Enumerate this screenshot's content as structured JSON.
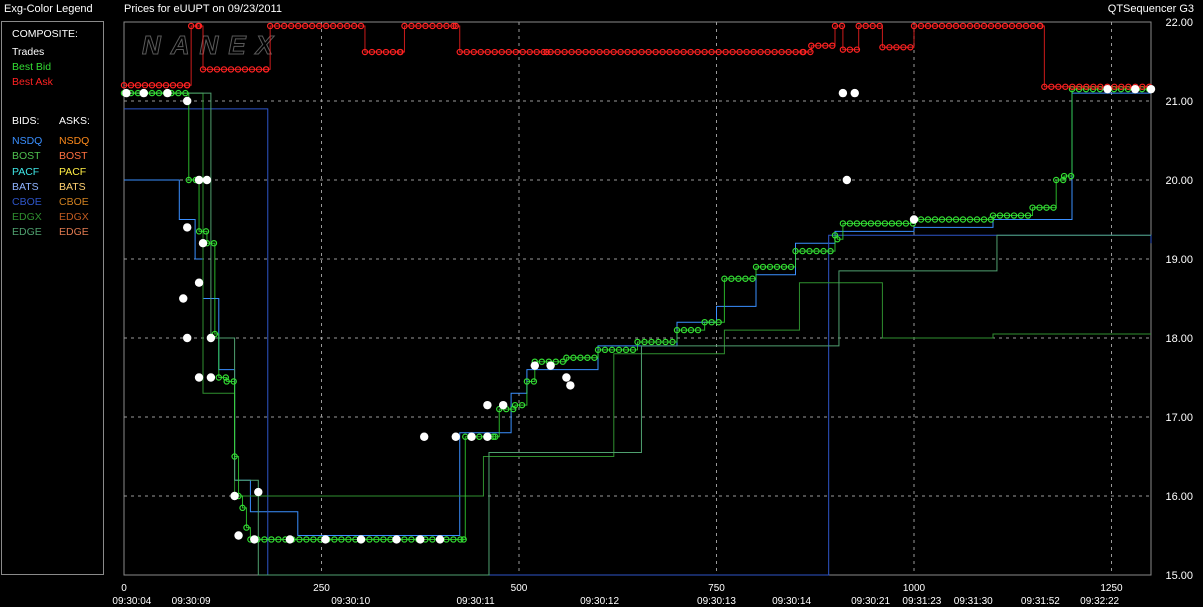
{
  "header": {
    "legend_title": "Exg-Color Legend",
    "chart_title": "Prices for  eUUPT  on  09/23/2011",
    "app_name": "QTSequencer G3"
  },
  "watermark": "NANEX",
  "legend": {
    "composite_heading": "COMPOSITE:",
    "composite": [
      {
        "label": "Trades",
        "color": "#ffffff"
      },
      {
        "label": "Best Bid",
        "color": "#33dd33"
      },
      {
        "label": "Best Ask",
        "color": "#ff2222"
      }
    ],
    "bids_heading": "BIDS:",
    "asks_heading": "ASKS:",
    "bids": [
      {
        "label": "NSDQ",
        "color": "#3a8fff"
      },
      {
        "label": "BOST",
        "color": "#4fc04f"
      },
      {
        "label": "PACF",
        "color": "#3ee6e6"
      },
      {
        "label": "BATS",
        "color": "#8fb4ff"
      },
      {
        "label": "CBOE",
        "color": "#2e55c8"
      },
      {
        "label": "EDGX",
        "color": "#2f8f2f"
      },
      {
        "label": "EDGE",
        "color": "#4fa06f"
      }
    ],
    "asks": [
      {
        "label": "NSDQ",
        "color": "#ff8a1a"
      },
      {
        "label": "BOST",
        "color": "#ff7040"
      },
      {
        "label": "PACF",
        "color": "#ffee44"
      },
      {
        "label": "BATS",
        "color": "#ffd070"
      },
      {
        "label": "CBOE",
        "color": "#d08020"
      },
      {
        "label": "EDGX",
        "color": "#c05a20"
      },
      {
        "label": "EDGE",
        "color": "#e07a50"
      }
    ]
  },
  "chart_data": {
    "type": "line",
    "title": "Prices for  eUUPT  on  09/23/2011",
    "xlim": [
      0,
      1300
    ],
    "ylim": [
      15.0,
      22.0
    ],
    "grid": true,
    "legend_placement": "left panel",
    "y_ticks": [
      "15.00",
      "16.00",
      "17.00",
      "18.00",
      "19.00",
      "20.00",
      "21.00",
      "22.00"
    ],
    "x_ticks": [
      0,
      250,
      500,
      750,
      1000,
      1250
    ],
    "time_labels": [
      {
        "x": 10,
        "label": "09:30:04"
      },
      {
        "x": 85,
        "label": "09:30:09"
      },
      {
        "x": 287,
        "label": "09:30:10"
      },
      {
        "x": 445,
        "label": "09:30:11"
      },
      {
        "x": 602,
        "label": "09:30:12"
      },
      {
        "x": 750,
        "label": "09:30:13"
      },
      {
        "x": 845,
        "label": "09:30:14"
      },
      {
        "x": 945,
        "label": "09:30:21"
      },
      {
        "x": 1010,
        "label": "09:31:23"
      },
      {
        "x": 1075,
        "label": "09:31:30"
      },
      {
        "x": 1160,
        "label": "09:31:52"
      },
      {
        "x": 1235,
        "label": "09:32:22"
      }
    ],
    "series": [
      {
        "name": "Trades",
        "kind": "dots",
        "color": "#ffffff",
        "points": [
          [
            3,
            21.1
          ],
          [
            25,
            21.1
          ],
          [
            55,
            21.1
          ],
          [
            80,
            21.0
          ],
          [
            95,
            20.0
          ],
          [
            105,
            20.0
          ],
          [
            80,
            19.4
          ],
          [
            100,
            19.2
          ],
          [
            95,
            18.7
          ],
          [
            75,
            18.5
          ],
          [
            80,
            18.0
          ],
          [
            110,
            18.0
          ],
          [
            95,
            17.5
          ],
          [
            110,
            17.5
          ],
          [
            140,
            16.0
          ],
          [
            170,
            16.05
          ],
          [
            145,
            15.5
          ],
          [
            165,
            15.45
          ],
          [
            210,
            15.45
          ],
          [
            255,
            15.45
          ],
          [
            300,
            15.45
          ],
          [
            345,
            15.45
          ],
          [
            375,
            15.45
          ],
          [
            400,
            15.45
          ],
          [
            380,
            16.75
          ],
          [
            420,
            16.75
          ],
          [
            440,
            16.75
          ],
          [
            460,
            16.75
          ],
          [
            460,
            17.15
          ],
          [
            480,
            17.15
          ],
          [
            520,
            17.65
          ],
          [
            540,
            17.65
          ],
          [
            560,
            17.5
          ],
          [
            565,
            17.4
          ],
          [
            910,
            21.1
          ],
          [
            925,
            21.1
          ],
          [
            915,
            20.0
          ],
          [
            1000,
            19.5
          ],
          [
            1245,
            21.15
          ],
          [
            1280,
            21.15
          ],
          [
            1300,
            21.15
          ]
        ]
      },
      {
        "name": "Best Bid",
        "kind": "step-dots",
        "color": "#33dd33",
        "points": [
          [
            0,
            21.1
          ],
          [
            60,
            21.1
          ],
          [
            82,
            20.0
          ],
          [
            95,
            19.35
          ],
          [
            105,
            19.2
          ],
          [
            115,
            18.05
          ],
          [
            120,
            17.5
          ],
          [
            130,
            17.45
          ],
          [
            140,
            16.5
          ],
          [
            145,
            16.0
          ],
          [
            150,
            15.85
          ],
          [
            155,
            15.6
          ],
          [
            160,
            15.45
          ],
          [
            430,
            15.45
          ],
          [
            432,
            16.75
          ],
          [
            470,
            16.75
          ],
          [
            475,
            17.1
          ],
          [
            495,
            17.15
          ],
          [
            510,
            17.45
          ],
          [
            520,
            17.7
          ],
          [
            560,
            17.75
          ],
          [
            600,
            17.85
          ],
          [
            650,
            17.95
          ],
          [
            700,
            18.1
          ],
          [
            735,
            18.2
          ],
          [
            760,
            18.75
          ],
          [
            800,
            18.9
          ],
          [
            850,
            19.1
          ],
          [
            900,
            19.3
          ],
          [
            903,
            19.25
          ],
          [
            910,
            19.45
          ],
          [
            1000,
            19.5
          ],
          [
            1100,
            19.55
          ],
          [
            1150,
            19.65
          ],
          [
            1180,
            20.0
          ],
          [
            1190,
            20.05
          ],
          [
            1200,
            21.15
          ],
          [
            1300,
            21.15
          ]
        ]
      },
      {
        "name": "Best Ask",
        "kind": "step-dots",
        "color": "#ff2222",
        "points": [
          [
            0,
            21.2
          ],
          [
            80,
            21.2
          ],
          [
            85,
            21.95
          ],
          [
            95,
            21.95
          ],
          [
            100,
            21.4
          ],
          [
            180,
            21.4
          ],
          [
            185,
            21.95
          ],
          [
            300,
            21.95
          ],
          [
            305,
            21.62
          ],
          [
            350,
            21.62
          ],
          [
            355,
            21.95
          ],
          [
            420,
            21.95
          ],
          [
            425,
            21.62
          ],
          [
            535,
            21.62
          ],
          [
            540,
            21.62
          ],
          [
            860,
            21.62
          ],
          [
            870,
            21.7
          ],
          [
            900,
            21.95
          ],
          [
            910,
            21.65
          ],
          [
            930,
            21.95
          ],
          [
            960,
            21.68
          ],
          [
            1000,
            21.95
          ],
          [
            1160,
            21.95
          ],
          [
            1165,
            21.18
          ],
          [
            1300,
            21.18
          ]
        ]
      },
      {
        "name": "NSDQ",
        "kind": "line",
        "color": "#3a8fff",
        "points": [
          [
            0,
            20.0
          ],
          [
            60,
            20.0
          ],
          [
            70,
            19.5
          ],
          [
            90,
            19.0
          ],
          [
            100,
            18.5
          ],
          [
            120,
            17.6
          ],
          [
            140,
            16.2
          ],
          [
            160,
            15.8
          ],
          [
            200,
            15.8
          ],
          [
            220,
            15.5
          ],
          [
            280,
            15.5
          ],
          [
            400,
            15.5
          ],
          [
            425,
            16.8
          ],
          [
            470,
            16.8
          ],
          [
            490,
            17.3
          ],
          [
            510,
            17.6
          ],
          [
            560,
            17.6
          ],
          [
            600,
            17.9
          ],
          [
            700,
            18.2
          ],
          [
            750,
            18.4
          ],
          [
            800,
            18.8
          ],
          [
            850,
            19.2
          ],
          [
            900,
            19.35
          ],
          [
            1000,
            19.4
          ],
          [
            1100,
            19.5
          ],
          [
            1200,
            21.1
          ],
          [
            1300,
            21.1
          ]
        ]
      },
      {
        "name": "CBOE",
        "kind": "line",
        "color": "#2e55c8",
        "points": [
          [
            0,
            20.9
          ],
          [
            90,
            20.9
          ],
          [
            95,
            20.9
          ],
          [
            180,
            20.9
          ],
          [
            182,
            15.0
          ],
          [
            890,
            15.0
          ],
          [
            892,
            19.3
          ],
          [
            950,
            19.3
          ],
          [
            1050,
            19.3
          ],
          [
            1100,
            19.3
          ],
          [
            1200,
            19.3
          ],
          [
            1300,
            19.2
          ]
        ]
      },
      {
        "name": "EDGX",
        "kind": "line",
        "color": "#2f8f2f",
        "points": [
          [
            0,
            21.1
          ],
          [
            50,
            21.1
          ],
          [
            60,
            21.1
          ],
          [
            100,
            17.3
          ],
          [
            140,
            16.0
          ],
          [
            450,
            16.0
          ],
          [
            455,
            16.5
          ],
          [
            600,
            16.5
          ],
          [
            620,
            17.8
          ],
          [
            750,
            17.8
          ],
          [
            760,
            18.1
          ],
          [
            850,
            18.1
          ],
          [
            855,
            18.7
          ],
          [
            950,
            18.7
          ],
          [
            960,
            18.0
          ],
          [
            1100,
            18.05
          ],
          [
            1300,
            18.05
          ]
        ]
      },
      {
        "name": "EDGE",
        "kind": "line",
        "color": "#4fa06f",
        "points": [
          [
            0,
            21.1
          ],
          [
            70,
            21.1
          ],
          [
            110,
            18.0
          ],
          [
            140,
            16.2
          ],
          [
            170,
            15.0
          ],
          [
            460,
            15.0
          ],
          [
            462,
            16.55
          ],
          [
            650,
            16.55
          ],
          [
            655,
            17.9
          ],
          [
            900,
            17.9
          ],
          [
            905,
            18.85
          ],
          [
            1100,
            18.85
          ],
          [
            1105,
            19.3
          ],
          [
            1300,
            19.3
          ]
        ]
      }
    ],
    "annotations": []
  }
}
